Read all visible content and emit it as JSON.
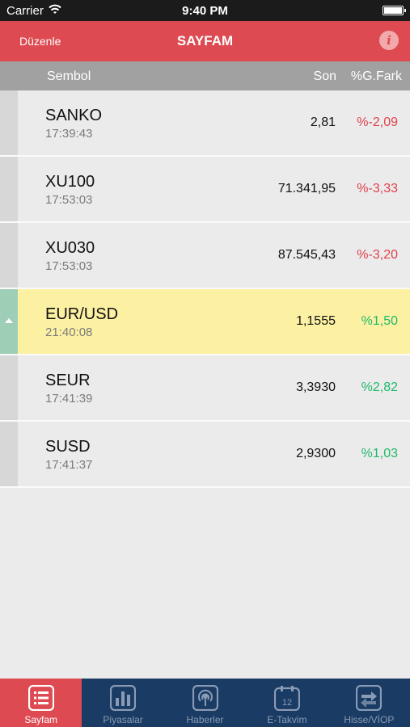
{
  "status_bar": {
    "carrier": "Carrier",
    "time": "9:40 PM"
  },
  "nav": {
    "edit_label": "Düzenle",
    "title": "SAYFAM"
  },
  "columns": {
    "symbol": "Sembol",
    "last": "Son",
    "change": "%G.Fark"
  },
  "rows": [
    {
      "symbol": "SANKO",
      "time": "17:39:43",
      "last": "2,81",
      "change": "%-2,09",
      "direction": "down"
    },
    {
      "symbol": "XU100",
      "time": "17:53:03",
      "last": "71.341,95",
      "change": "%-3,33",
      "direction": "down"
    },
    {
      "symbol": "XU030",
      "time": "17:53:03",
      "last": "87.545,43",
      "change": "%-3,20",
      "direction": "down"
    },
    {
      "symbol": "EUR/USD",
      "time": "21:40:08",
      "last": "1,1555",
      "change": "%1,50",
      "direction": "up",
      "highlighted": true
    },
    {
      "symbol": "SEUR",
      "time": "17:41:39",
      "last": "3,3930",
      "change": "%2,82",
      "direction": "up"
    },
    {
      "symbol": "SUSD",
      "time": "17:41:37",
      "last": "2,9300",
      "change": "%1,03",
      "direction": "up"
    }
  ],
  "tabs": [
    {
      "label": "Sayfam",
      "icon": "list-icon",
      "active": true
    },
    {
      "label": "Piyasalar",
      "icon": "bar-chart-icon"
    },
    {
      "label": "Haberler",
      "icon": "broadcast-icon"
    },
    {
      "label": "E-Takvim",
      "icon": "calendar-icon",
      "badge": "12"
    },
    {
      "label": "Hisse/VİOP",
      "icon": "exchange-icon"
    }
  ],
  "colors": {
    "accent": "#dd4a51",
    "tab_bar": "#1a3b63",
    "negative": "#e0414c",
    "positive": "#1fb96a",
    "highlight_row": "#fcf0a3"
  }
}
